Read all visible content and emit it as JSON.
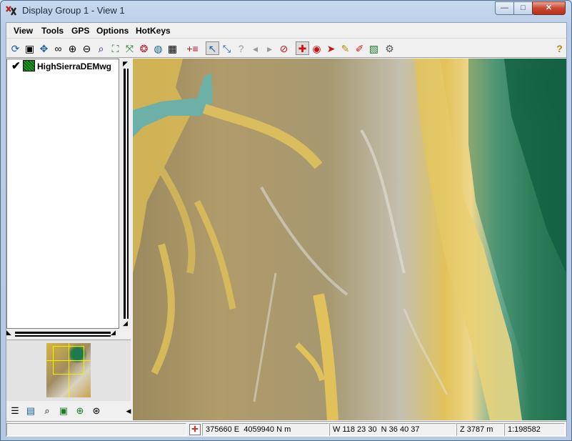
{
  "window": {
    "title": "Display Group 1 - View 1",
    "minimize_glyph": "—",
    "maximize_glyph": "□",
    "close_glyph": "✕"
  },
  "menu": [
    "View",
    "Tools",
    "GPS",
    "Options",
    "HotKeys"
  ],
  "toolbar": {
    "help_glyph": "?"
  },
  "legend": {
    "check_glyph": "✔",
    "layer_name": "HighSierraDEMwg"
  },
  "status": {
    "map_coords": "375660 E  4059940 N m",
    "latlon": "W 118 23 30  N 36 40 37",
    "elevation": "Z 3787 m",
    "scale": "1:198582"
  },
  "colors": {
    "close_red": "#c8472f",
    "overview_box": "#f4f000",
    "forest_green": "#0f5d40",
    "sand_yellow": "#e1c25a"
  }
}
